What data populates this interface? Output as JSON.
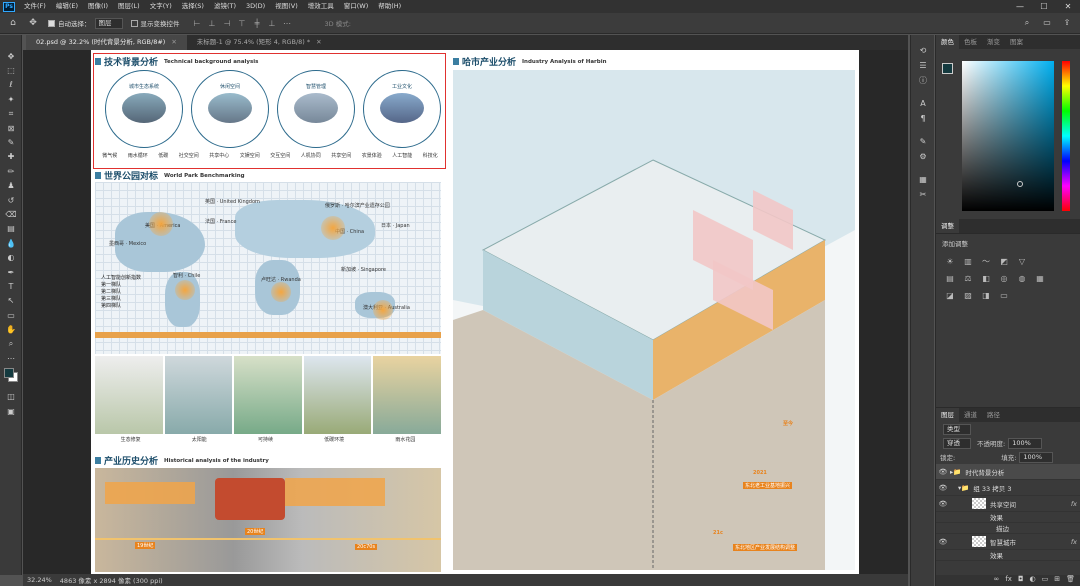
{
  "menubar": {
    "logo": "Ps",
    "items": [
      "文件(F)",
      "编辑(E)",
      "图像(I)",
      "图层(L)",
      "文字(Y)",
      "选择(S)",
      "滤镜(T)",
      "3D(D)",
      "视图(V)",
      "增效工具",
      "窗口(W)",
      "帮助(H)"
    ],
    "window_controls": [
      "—",
      "☐",
      "✕"
    ]
  },
  "options": {
    "auto_select_label": "自动选择：",
    "auto_select_value": "图层",
    "show_transform_label": "显示变换控件",
    "mode3d_label": "3D 模式:"
  },
  "tabs": [
    {
      "label": "02.psd @ 32.2% (时代背景分析, RGB/8#)",
      "active": true
    },
    {
      "label": "未标题-1 @ 75.4% (矩形 4, RGB/8) *",
      "active": false
    }
  ],
  "status": {
    "zoom": "32.24%",
    "doc_size": "4863 像素 x 2894 像素 (300 ppi)"
  },
  "poster": {
    "tech_title": "技术背景分析",
    "tech_title_en": "Technical background analysis",
    "tech_circles": [
      {
        "label": "城市生态系统",
        "sub": [
          "微气候",
          "雨水循环",
          "低碳"
        ],
        "bottom": [
          "微气候",
          "雨水循环",
          "低碳"
        ]
      },
      {
        "label": "休闲空间",
        "sub": [
          "社交空间",
          "共享中心"
        ],
        "bottom": [
          "社交空间",
          "共享中心",
          "文娱空间"
        ]
      },
      {
        "label": "智慧管理",
        "sub": [
          "交互空间",
          "人机协同"
        ],
        "bottom": [
          "交互空间",
          "人机协同",
          "共享空间"
        ]
      },
      {
        "label": "工业文化",
        "sub": [
          "农景体验",
          "人工智能"
        ],
        "bottom": [
          "农景体验",
          "人工智能",
          "科技化"
        ]
      }
    ],
    "world_title": "世界公园对标",
    "world_title_en": "World Park Benchmarking",
    "countries": [
      {
        "label": "英国 · United Kingdom"
      },
      {
        "label": "美国 · America"
      },
      {
        "label": "法国 · France"
      },
      {
        "label": "俄罗斯 · 哈尔滨产业遗存公园"
      },
      {
        "label": "墨西哥 · Mexico"
      },
      {
        "label": "中国 · China"
      },
      {
        "label": "日本 · Japan"
      },
      {
        "label": "智利 · Chile"
      },
      {
        "label": "卢旺达 · Rwanda"
      },
      {
        "label": "新加坡 · Singapore"
      },
      {
        "label": "澳大利亚 · Australia"
      }
    ],
    "legend_title": "人工智能创新指数",
    "legend_items": [
      "第一梯队",
      "第二梯队",
      "第三梯队",
      "第四梯队"
    ],
    "park_captions": [
      "生态修复",
      "太阳能",
      "可持续",
      "低碳环境",
      "雨水花园"
    ],
    "industry_title": "产业历史分析",
    "industry_title_en": "Historical analysis of the industry",
    "timeline": [
      "19世纪",
      "20世纪",
      "20c70s",
      "21c",
      "2021",
      "至今"
    ],
    "harbin_title": "哈市产业分析",
    "harbin_title_en": "Industry Analysis of Harbin",
    "harbin_note_a": "东北老工业基地振兴",
    "harbin_note_b": "东北地区产业发展结构调整"
  },
  "layers": {
    "mode": "穿透",
    "opacity_label": "不透明度:",
    "opacity": "100%",
    "lock_label": "锁定:",
    "fill_label": "填充:",
    "fill": "100%",
    "filter": "类型",
    "items": [
      {
        "name": "时代背景分析",
        "type": "folder"
      },
      {
        "name": "组 33 拷贝 3",
        "type": "folder"
      },
      {
        "name": "共享空间",
        "type": "layer"
      },
      {
        "name": "效果",
        "type": "effect"
      },
      {
        "name": "描边",
        "type": "effect"
      },
      {
        "name": "智慧城市",
        "type": "layer"
      },
      {
        "name": "效果",
        "type": "effect"
      }
    ]
  },
  "panels": {
    "color_tabs": [
      "颜色",
      "色板",
      "渐变",
      "图案"
    ],
    "adj_tabs": [
      "调整"
    ],
    "adj_title": "添加调整",
    "layer_tabs": [
      "图层",
      "通道",
      "路径"
    ]
  },
  "colors": {
    "accent_blue": "#2c6a8c",
    "accent_orange": "#e8831d",
    "highlight_red": "#e0312f"
  }
}
